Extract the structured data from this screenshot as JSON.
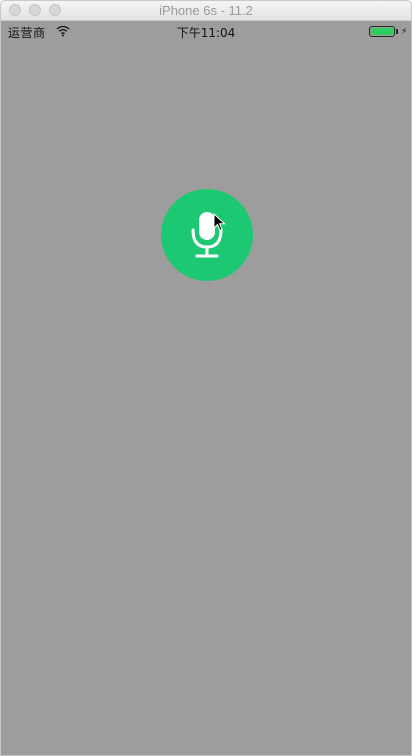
{
  "window": {
    "title": "iPhone 6s - 11.2"
  },
  "statusbar": {
    "carrier": "运营商",
    "time": "下午11:04",
    "battery_level": 1.0,
    "battery_color": "#2ecc5f"
  },
  "mic_button": {
    "color": "#1dc872",
    "icon": "microphone-icon"
  },
  "colors": {
    "screen_background": "#9e9e9e"
  }
}
